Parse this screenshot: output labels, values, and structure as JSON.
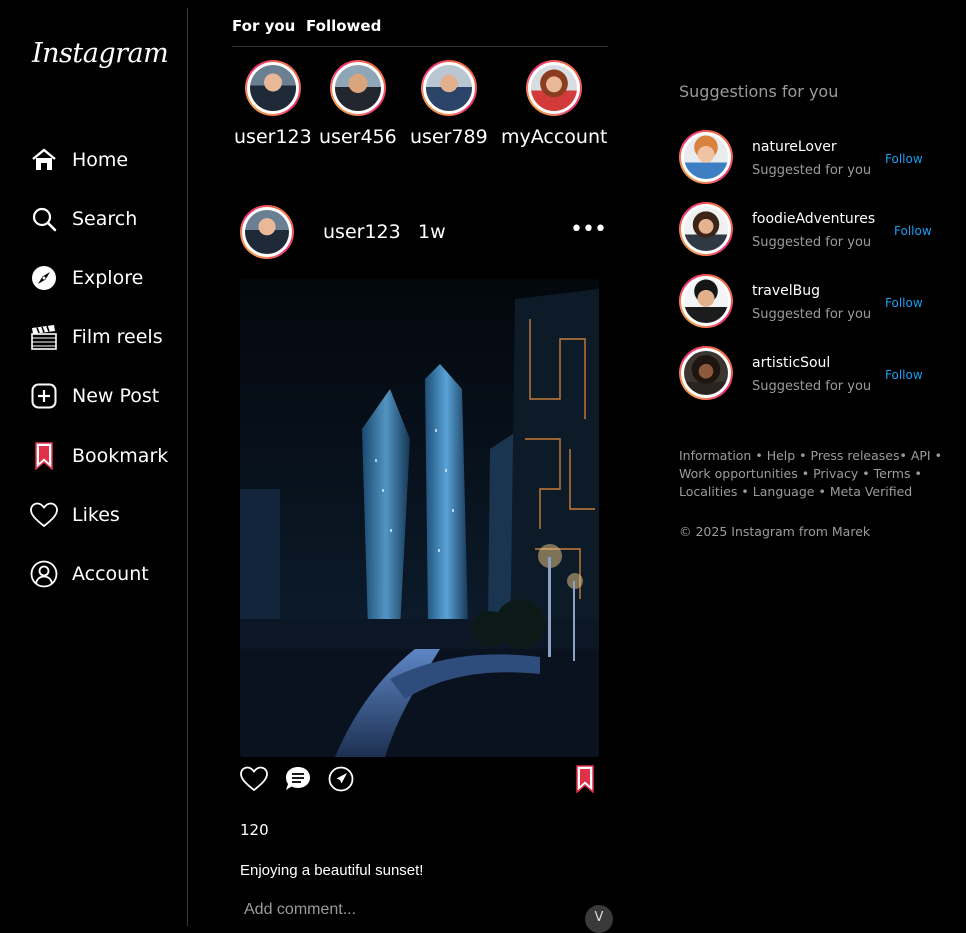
{
  "app": {
    "logo": "Instagram"
  },
  "nav": [
    {
      "label": "Home",
      "icon": "home-icon"
    },
    {
      "label": "Search",
      "icon": "search-icon"
    },
    {
      "label": "Explore",
      "icon": "compass-icon"
    },
    {
      "label": "Film reels",
      "icon": "clapperboard-icon"
    },
    {
      "label": "New Post",
      "icon": "plus-square-icon"
    },
    {
      "label": "Bookmark",
      "icon": "bookmark-icon"
    },
    {
      "label": "Likes",
      "icon": "heart-icon"
    },
    {
      "label": "Account",
      "icon": "user-circle-icon"
    }
  ],
  "tabs": [
    {
      "label": "For you"
    },
    {
      "label": "Followed"
    }
  ],
  "stories": [
    {
      "name": "user123"
    },
    {
      "name": "user456"
    },
    {
      "name": "user789"
    },
    {
      "name": "myAccount"
    }
  ],
  "post": {
    "user": "user123",
    "time": "1w",
    "more": "•••",
    "likes": "120",
    "caption": "Enjoying a beautiful sunset!",
    "comment_placeholder": "Add comment...",
    "scroll_label": "V"
  },
  "suggestions": {
    "title": "Suggestions for you",
    "items": [
      {
        "name": "natureLover",
        "sub": "Suggested for you",
        "action": "Follow"
      },
      {
        "name": "foodieAdventures",
        "sub": "Suggested for you",
        "action": "Follow"
      },
      {
        "name": "travelBug",
        "sub": "Suggested for you",
        "action": "Follow"
      },
      {
        "name": "artisticSoul",
        "sub": "Suggested for you",
        "action": "Follow"
      }
    ]
  },
  "footer": {
    "links": [
      "Information",
      "Help",
      "Press releases",
      "API",
      "Work opportunities",
      "Privacy",
      "Terms",
      "Localities",
      "Language",
      "Meta Verified"
    ],
    "copyright": "© 2025 Instagram from Marek"
  },
  "colors": {
    "background": "#000000",
    "accent": "#1c9cf0",
    "bookmark": "#e0314b"
  }
}
